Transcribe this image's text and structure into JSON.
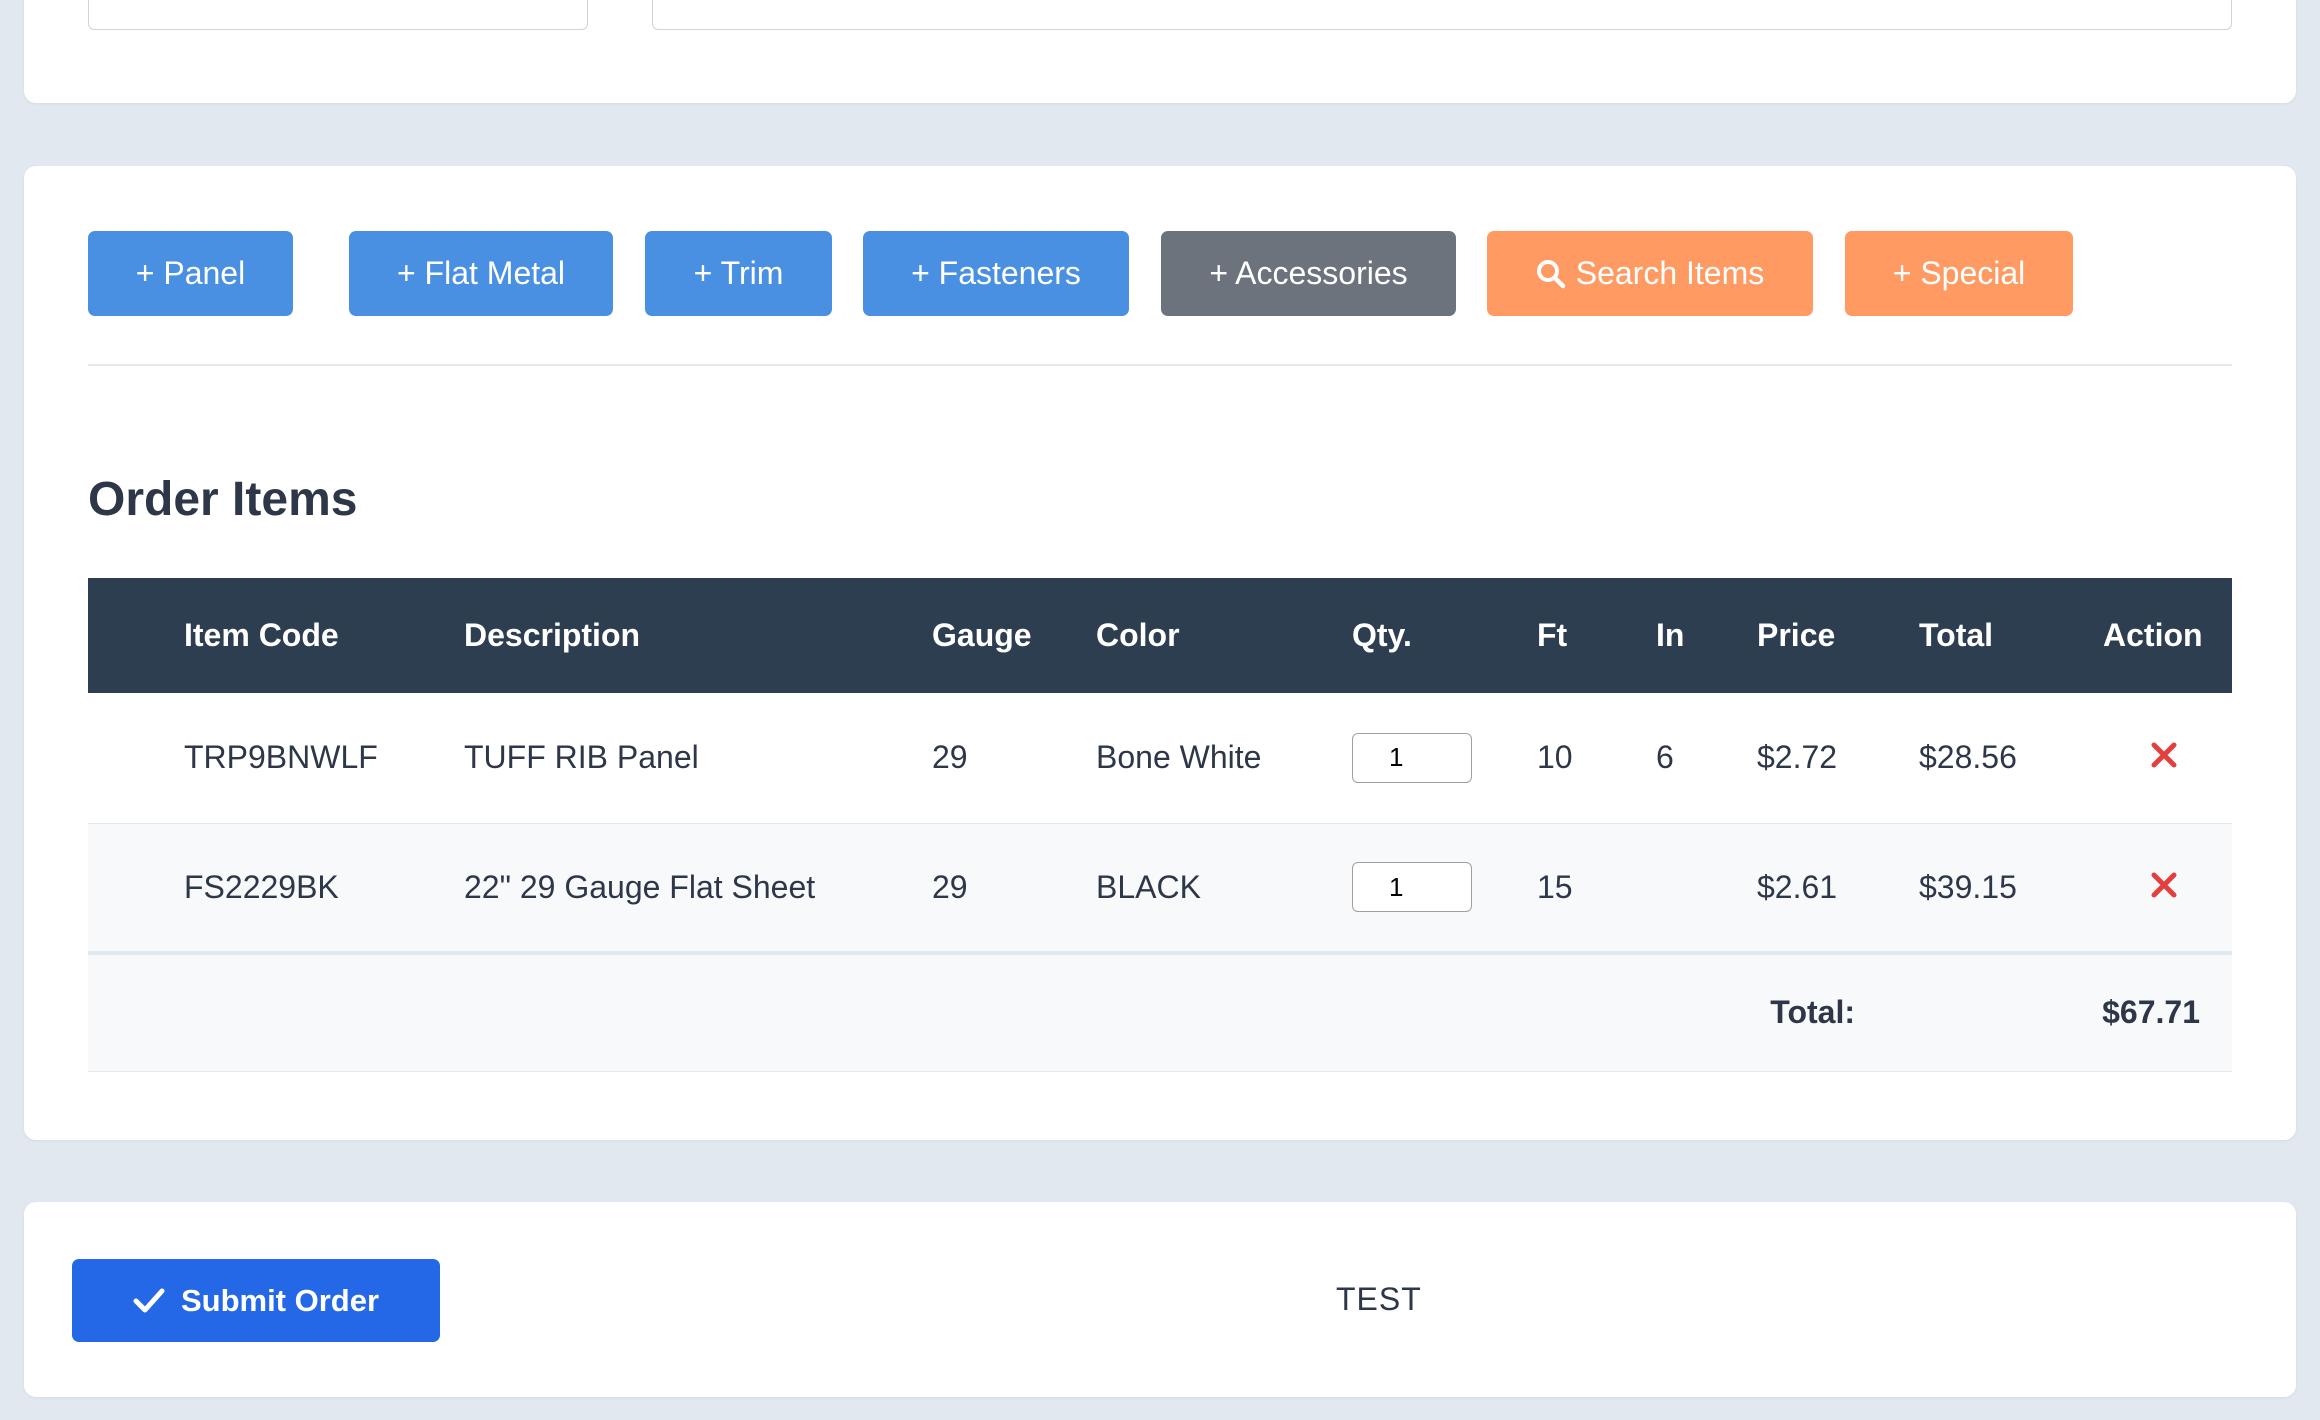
{
  "colors": {
    "page_bg": "#e2e8f0",
    "card_bg": "#ffffff",
    "button_blue": "#4a90e2",
    "button_gray": "#6c737d",
    "button_orange": "#ff9a62",
    "table_header_bg": "#2c3e50",
    "delete_red": "#e53e3e",
    "submit_blue": "#2468e8"
  },
  "add_buttons": [
    {
      "label": "+ Panel",
      "style": "blue"
    },
    {
      "label": "+ Flat Metal",
      "style": "blue"
    },
    {
      "label": "+ Trim",
      "style": "blue"
    },
    {
      "label": "+ Fasteners",
      "style": "blue"
    },
    {
      "label": "+ Accessories",
      "style": "gray"
    },
    {
      "label": "Search Items",
      "style": "orange",
      "icon": "search-icon"
    },
    {
      "label": "+ Special",
      "style": "orange"
    }
  ],
  "order": {
    "title": "Order Items",
    "columns": [
      "Item Code",
      "Description",
      "Gauge",
      "Color",
      "Qty.",
      "Ft",
      "In",
      "Price",
      "Total",
      "Action"
    ],
    "rows": [
      {
        "item_code": "TRP9BNWLF",
        "description": "TUFF RIB Panel",
        "gauge": "29",
        "color": "Bone White",
        "qty": "1",
        "ft": "10",
        "in": "6",
        "price": "$2.72",
        "total": "$28.56",
        "action_icon": "delete-icon"
      },
      {
        "item_code": "FS2229BK",
        "description": "22\" 29 Gauge Flat Sheet",
        "gauge": "29",
        "color": "BLACK",
        "qty": "1",
        "ft": "15",
        "in": "",
        "price": "$2.61",
        "total": "$39.15",
        "action_icon": "delete-icon"
      }
    ],
    "total_label": "Total:",
    "total_value": "$67.71"
  },
  "footer": {
    "submit_label": "Submit Order",
    "submit_icon": "check-icon",
    "status_text": "TEST"
  }
}
